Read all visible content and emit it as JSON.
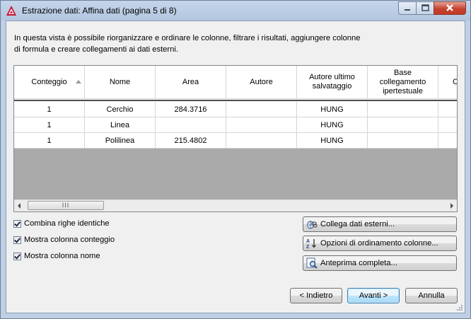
{
  "window": {
    "title": "Estrazione dati: Affina dati (pagina 5 di 8)"
  },
  "description": "In questa vista è possibile riorganizzare e ordinare le colonne, filtrare i risultati, aggiungere colonne di formula e creare collegamenti ai dati esterni.",
  "table": {
    "columns": [
      "Conteggio",
      "Nome",
      "Area",
      "Autore",
      "Autore ultimo salvataggio",
      "Base collegamento ipertestuale",
      "C"
    ],
    "rows": [
      [
        "1",
        "Cerchio",
        "284.3716",
        "",
        "HUNG",
        "",
        ""
      ],
      [
        "1",
        "Linea",
        "",
        "",
        "HUNG",
        "",
        ""
      ],
      [
        "1",
        "Polilinea",
        "215.4802",
        "",
        "HUNG",
        "",
        ""
      ]
    ],
    "scroll_thumb": "III"
  },
  "options": {
    "combine": {
      "label": "Combina righe identiche",
      "checked": true
    },
    "count_col": {
      "label": "Mostra colonna conteggio",
      "checked": true
    },
    "name_col": {
      "label": "Mostra colonna nome",
      "checked": true
    }
  },
  "buttons": {
    "link_external": "Collega dati esterni...",
    "sort_options": "Opzioni di ordinamento colonne...",
    "full_preview": "Anteprima completa...",
    "back": "< Indietro",
    "next": "Avanti >",
    "cancel": "Annulla"
  },
  "icons": {
    "app": "autocad-icon",
    "link": "link-data-icon",
    "sort": "sort-az-icon",
    "preview": "preview-magnifier-icon"
  },
  "colors": {
    "titlebar": "#bfcfe6",
    "close_button": "#c5432f",
    "grid_empty": "#aaaaaa"
  }
}
